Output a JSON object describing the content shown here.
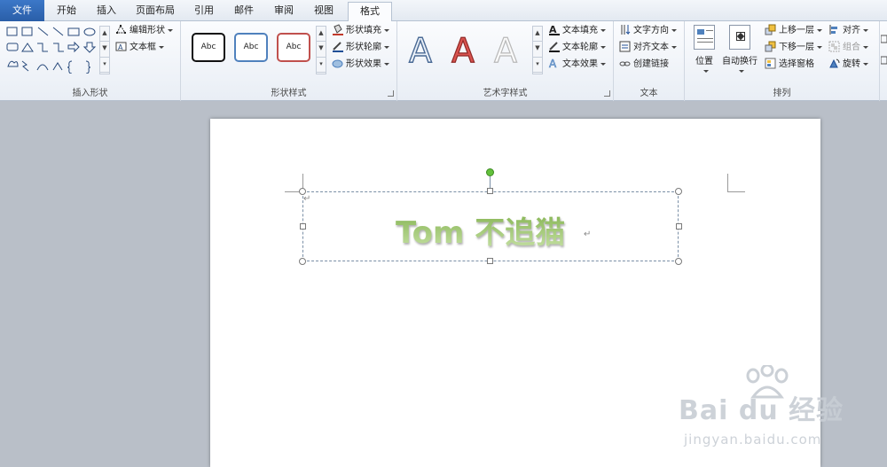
{
  "tabs": [
    {
      "label": "文件",
      "active": false,
      "file": true
    },
    {
      "label": "开始",
      "active": false
    },
    {
      "label": "插入",
      "active": false
    },
    {
      "label": "页面布局",
      "active": false
    },
    {
      "label": "引用",
      "active": false
    },
    {
      "label": "邮件",
      "active": false
    },
    {
      "label": "审阅",
      "active": false
    },
    {
      "label": "视图",
      "active": false
    },
    {
      "label": "格式",
      "active": true
    }
  ],
  "ribbon": {
    "insert_shapes": {
      "label": "插入形状",
      "edit_shape": "编辑形状",
      "text_box": "文本框"
    },
    "shape_styles": {
      "label": "形状样式",
      "presets": [
        "Abc",
        "Abc",
        "Abc"
      ],
      "preset_colors": [
        "#111111",
        "#4f81bd",
        "#c0504d"
      ],
      "shape_fill": "形状填充",
      "shape_outline": "形状轮廓",
      "shape_effects": "形状效果"
    },
    "wordart_styles": {
      "label": "艺术字样式",
      "presets": [
        "A",
        "A",
        "A"
      ],
      "text_fill": "文本填充",
      "text_outline": "文本轮廓",
      "text_effects": "文本效果"
    },
    "text": {
      "label": "文本",
      "text_direction": "文字方向",
      "align_text": "对齐文本",
      "create_link": "创建链接"
    },
    "arrange": {
      "label": "排列",
      "position": "位置",
      "wrap_text": "自动换行",
      "bring_forward": "上移一层",
      "send_backward": "下移一层",
      "selection_pane": "选择窗格",
      "align": "对齐",
      "group": "组合",
      "rotate": "旋转"
    }
  },
  "document": {
    "wordart_text": "Tom 不追猫"
  },
  "watermark": {
    "logo": "Bai du 经验",
    "url": "jingyan.baidu.com"
  }
}
